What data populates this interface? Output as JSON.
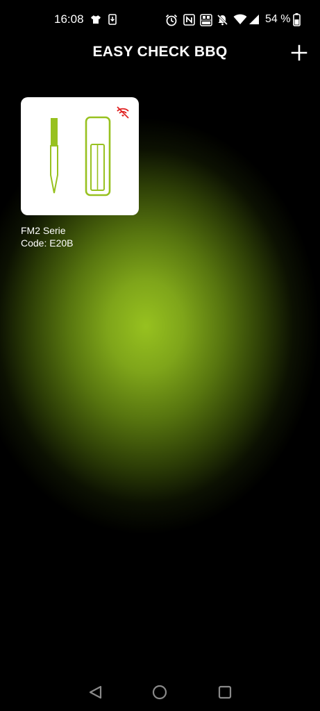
{
  "status_bar": {
    "time": "16:08",
    "battery_percent": "54 %",
    "icons": [
      "shirt-icon",
      "sim-download-icon",
      "alarm-icon",
      "nfc-icon",
      "volte-icon",
      "mute-icon",
      "wifi-icon",
      "signal-icon",
      "battery-icon"
    ]
  },
  "header": {
    "title": "EASY CHECK BBQ",
    "add_icon": "plus-icon"
  },
  "devices": [
    {
      "name": "FM2 Serie",
      "code": "Code: E20B",
      "connection_icon": "wifi-off-icon",
      "image_icon": "probe-thermometer-icon"
    }
  ],
  "nav_bar": {
    "icons": [
      "back-icon",
      "home-icon",
      "recents-icon"
    ]
  },
  "colors": {
    "accent": "#97c11f",
    "background": "#000000",
    "disconnect": "#e02020"
  }
}
